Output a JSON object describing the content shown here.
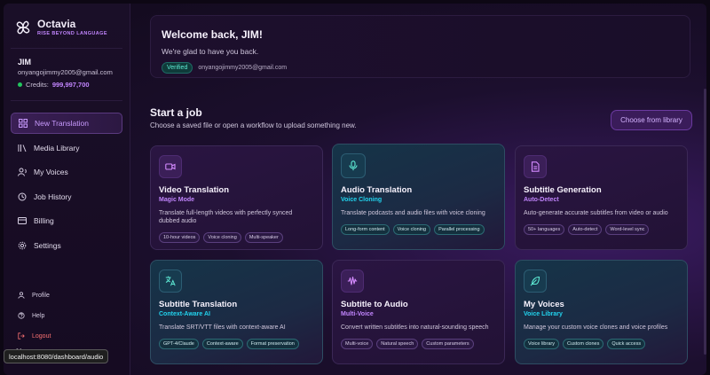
{
  "brand": {
    "name": "Octavia",
    "tagline": "RISE BEYOND LANGUAGE"
  },
  "user": {
    "name": "JIM",
    "email": "onyangojimmy2005@gmail.com",
    "credits_label": "Credits:",
    "credits_value": "999,997,700"
  },
  "nav": {
    "items": [
      {
        "label": "New Translation",
        "icon": "grid-icon",
        "active": true
      },
      {
        "label": "Media Library",
        "icon": "library-icon"
      },
      {
        "label": "My Voices",
        "icon": "voice-icon"
      },
      {
        "label": "Job History",
        "icon": "history-icon"
      },
      {
        "label": "Billing",
        "icon": "card-icon"
      },
      {
        "label": "Settings",
        "icon": "gear-icon"
      }
    ],
    "bottom": [
      {
        "label": "Profile",
        "icon": "user-icon"
      },
      {
        "label": "Help",
        "icon": "help-icon"
      },
      {
        "label": "Logout",
        "icon": "logout-icon"
      }
    ]
  },
  "status_url": "localhost:8080/dashboard/audio",
  "welcome": {
    "title": "Welcome back, JIM!",
    "subtitle": "We're glad to have you back.",
    "badge": "Verified",
    "email": "onyangojimmy2005@gmail.com"
  },
  "section": {
    "title": "Start a job",
    "subtitle": "Choose a saved file or open a workflow to upload something new.",
    "library_button": "Choose from library"
  },
  "cards": [
    {
      "title": "Video Translation",
      "subtitle": "Magic Mode",
      "desc": "Translate full-length videos with perfectly synced dubbed audio",
      "tags": [
        "10-hour videos",
        "Voice cloning",
        "Multi-speaker"
      ],
      "icon": "video-icon",
      "theme": "purple"
    },
    {
      "title": "Audio Translation",
      "subtitle": "Voice Cloning",
      "desc": "Translate podcasts and audio files with voice cloning",
      "tags": [
        "Long-form content",
        "Voice cloning",
        "Parallel processing"
      ],
      "icon": "mic-icon",
      "theme": "teal"
    },
    {
      "title": "Subtitle Generation",
      "subtitle": "Auto-Detect",
      "desc": "Auto-generate accurate subtitles from video or audio",
      "tags": [
        "50+ languages",
        "Auto-detect",
        "Word-level sync"
      ],
      "icon": "document-icon",
      "theme": "purple"
    },
    {
      "title": "Subtitle Translation",
      "subtitle": "Context-Aware AI",
      "desc": "Translate SRT/VTT files with context-aware AI",
      "tags": [
        "GPT-4/Claude",
        "Context-aware",
        "Format preservation"
      ],
      "icon": "translate-icon",
      "theme": "teal"
    },
    {
      "title": "Subtitle to Audio",
      "subtitle": "Multi-Voice",
      "desc": "Convert written subtitles into natural-sounding speech",
      "tags": [
        "Multi-voice",
        "Natural speech",
        "Custom parameters"
      ],
      "icon": "waveform-icon",
      "theme": "purple"
    },
    {
      "title": "My Voices",
      "subtitle": "Voice Library",
      "desc": "Manage your custom voice clones and voice profiles",
      "tags": [
        "Voice library",
        "Custom clones",
        "Quick access"
      ],
      "icon": "feather-icon",
      "theme": "teal"
    }
  ],
  "colors": {
    "accent_purple": "#c084fc",
    "accent_teal": "#22d3ee",
    "logout_red": "#f87171",
    "credits_dot": "#22c55e"
  }
}
